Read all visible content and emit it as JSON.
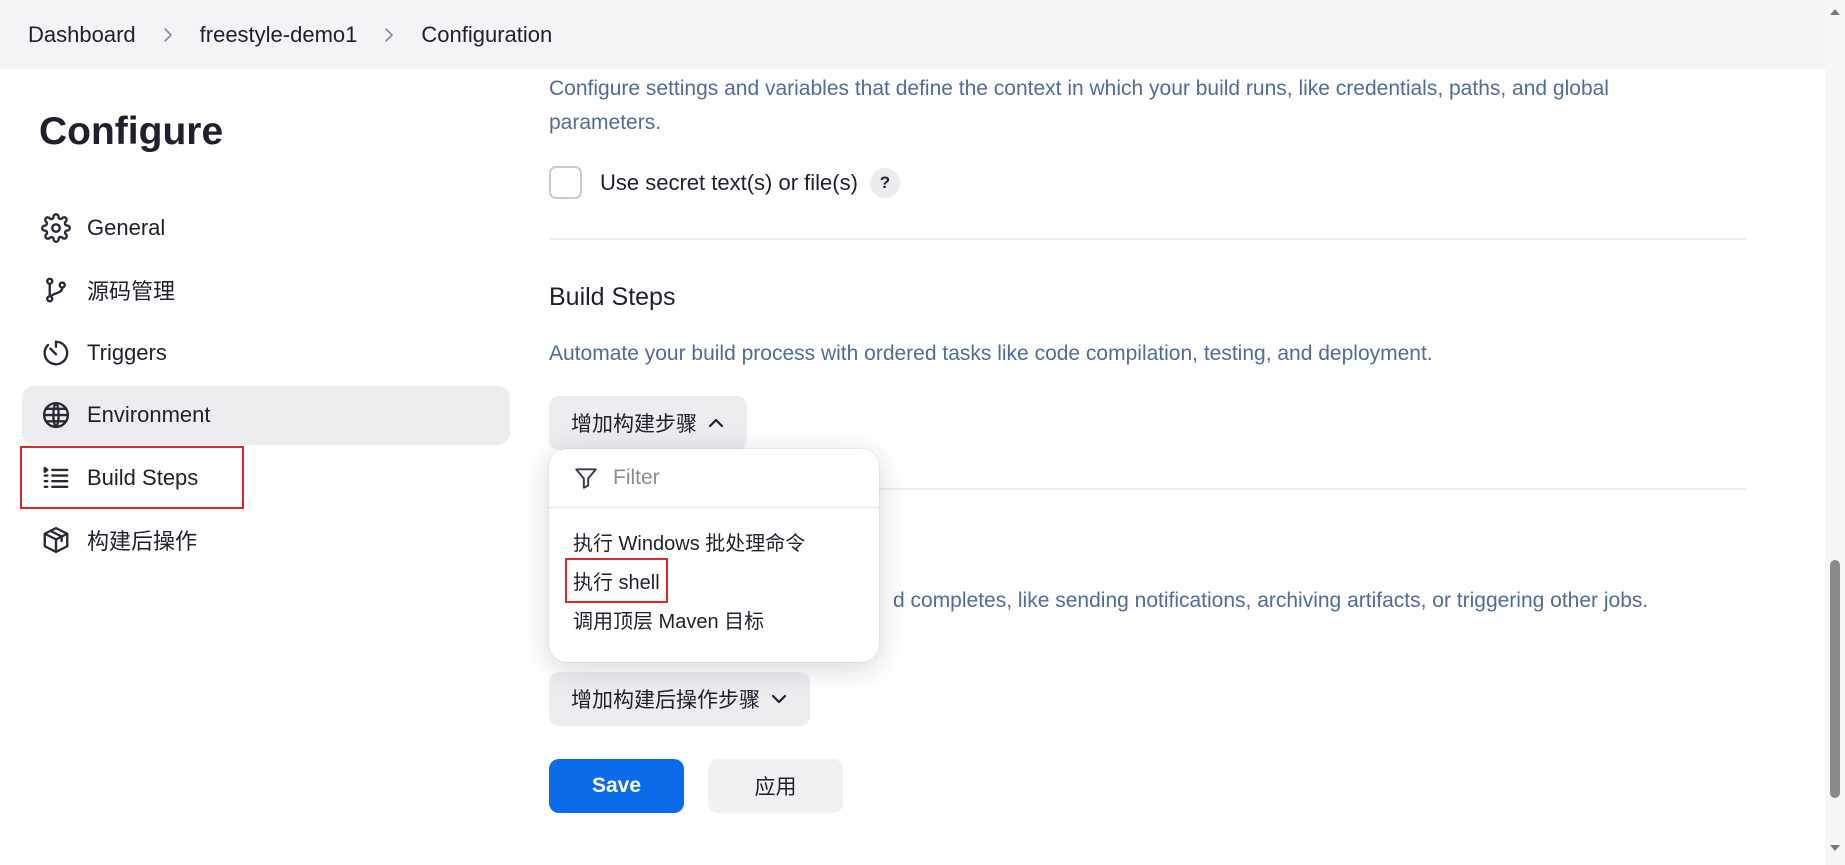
{
  "breadcrumb": {
    "items": [
      "Dashboard",
      "freestyle-demo1",
      "Configuration"
    ]
  },
  "sidebar": {
    "title": "Configure",
    "items": [
      {
        "label": "General",
        "icon": "gear-icon"
      },
      {
        "label": "源码管理",
        "icon": "git-branch-icon"
      },
      {
        "label": "Triggers",
        "icon": "timer-icon"
      },
      {
        "label": "Environment",
        "icon": "globe-icon"
      },
      {
        "label": "Build Steps",
        "icon": "list-steps-icon"
      },
      {
        "label": "构建后操作",
        "icon": "package-icon"
      }
    ]
  },
  "environment": {
    "description": "Configure settings and variables that define the context in which your build runs, like credentials, paths, and global parameters.",
    "secret_checkbox_label": "Use secret text(s) or file(s)",
    "help_label": "?"
  },
  "build_steps": {
    "title": "Build Steps",
    "description": "Automate your build process with ordered tasks like code compilation, testing, and deployment.",
    "add_button_label": "增加构建步骤"
  },
  "post_build": {
    "description_visible": "d completes, like sending notifications, archiving artifacts, or triggering other jobs.",
    "add_button_label": "增加构建后操作步骤"
  },
  "dropdown": {
    "filter_placeholder": "Filter",
    "options": [
      "执行 Windows 批处理命令",
      "执行 shell",
      "调用顶层 Maven 目标"
    ]
  },
  "actions": {
    "save_label": "Save",
    "apply_label": "应用"
  },
  "colors": {
    "primary": "#0b6be8",
    "highlight_box": "#e0262b",
    "description_text": "#4f6b9b"
  }
}
